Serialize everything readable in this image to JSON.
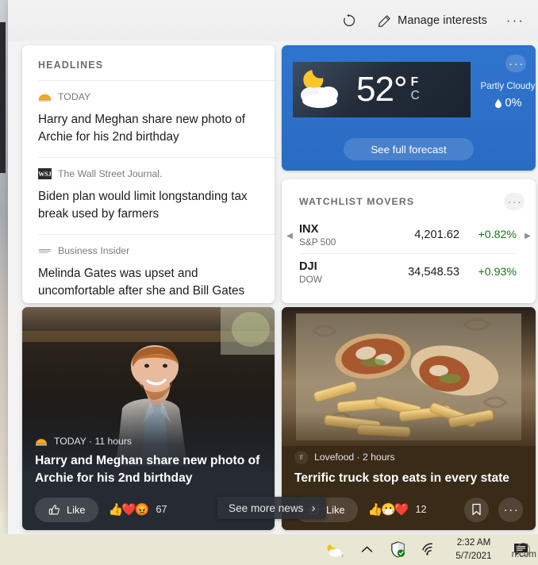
{
  "toolbar": {
    "refresh_label": "Refresh",
    "manage_label": "Manage interests",
    "more_label": "···"
  },
  "headlines": {
    "title": "HEADLINES",
    "items": [
      {
        "source": "TODAY",
        "source_icon": "today-logo",
        "headline": "Harry and Meghan share new photo of Archie for his 2nd birthday"
      },
      {
        "source": "The Wall Street Journal.",
        "source_icon": "wsj-logo",
        "headline": "Biden plan would limit longstanding tax break used by farmers"
      },
      {
        "source": "Business Insider",
        "source_icon": "business-insider-logo",
        "headline": "Melinda Gates was upset and uncomfortable after she and Bill Gates met with Jeffrey Epstein, The Daily Bea..."
      }
    ]
  },
  "weather": {
    "more_label": "···",
    "temperature": "52",
    "degree": "°",
    "unit_f": "F",
    "unit_c": "C",
    "condition": "Partly Cloudy",
    "precipitation": "0%",
    "forecast_label": "See full forecast",
    "icon": "moon-behind-cloud-icon",
    "accent": "#2a6cc4"
  },
  "watchlist": {
    "title": "WATCHLIST MOVERS",
    "more_label": "···",
    "prev_label": "◀",
    "next_label": "▶",
    "positive_color": "#107c10",
    "rows": [
      {
        "ticker": "INX",
        "name": "S&P 500",
        "price": "4,201.62",
        "change": "+0.82%"
      },
      {
        "ticker": "DJI",
        "name": "DOW",
        "price": "34,548.53",
        "change": "+0.93%"
      }
    ]
  },
  "articles": [
    {
      "source": "TODAY",
      "time": "11 hours",
      "meta": "TODAY · 11 hours",
      "headline": "Harry and Meghan share new photo of Archie for his 2nd birthday",
      "like_label": "Like",
      "reactions": "👍❤️😡",
      "reaction_count": "67",
      "image_alt": "prince-harry-photo"
    },
    {
      "source": "Lovefood",
      "time": "2 hours",
      "meta": "Lovefood · 2 hours",
      "headline": "Terrific truck stop eats in every state",
      "like_label": "Like",
      "reactions": "👍😷❤️",
      "reaction_count": "12",
      "image_alt": "wrap-and-fries-photo"
    }
  ],
  "see_more": {
    "label": "See more news",
    "chevron": "›"
  },
  "taskbar": {
    "weather_icon": "partly-cloudy-night-icon",
    "chevron_label": "^",
    "defender_icon": "shield-icon",
    "network_icon": "wifi-icon",
    "time": "2:32 AM",
    "date": "5/7/2021",
    "action_center_icon": "action-center-icon",
    "watermark": "n.com"
  }
}
